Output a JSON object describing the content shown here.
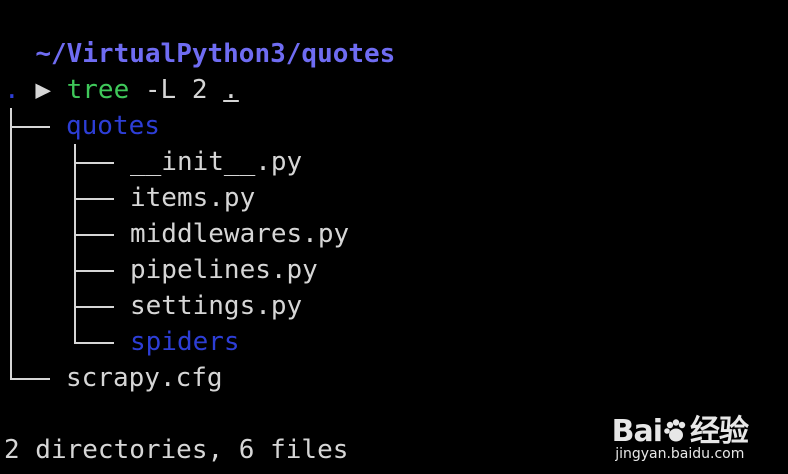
{
  "terminal": {
    "prompt_path": "~/VirtualPython3/quotes",
    "prompt_arrow": "▶",
    "command": "tree",
    "args": " -L 2 ",
    "arg_dot": ".",
    "root": ".",
    "tree": [
      {
        "name": "quotes",
        "type": "dir"
      },
      {
        "name": "__init__.py",
        "type": "file"
      },
      {
        "name": "items.py",
        "type": "file"
      },
      {
        "name": "middlewares.py",
        "type": "file"
      },
      {
        "name": "pipelines.py",
        "type": "file"
      },
      {
        "name": "settings.py",
        "type": "file"
      },
      {
        "name": "spiders",
        "type": "dir"
      },
      {
        "name": "scrapy.cfg",
        "type": "file"
      }
    ],
    "summary": "2 directories, 6 files"
  },
  "watermark": {
    "brand": "Bai",
    "brand_suffix": "经验",
    "url": "jingyan.baidu.com"
  },
  "colors": {
    "background": "#000000",
    "prompt_path": "#6f6cf2",
    "command": "#3fc85a",
    "directory": "#2d3ed6",
    "text": "#d6d6d6"
  }
}
